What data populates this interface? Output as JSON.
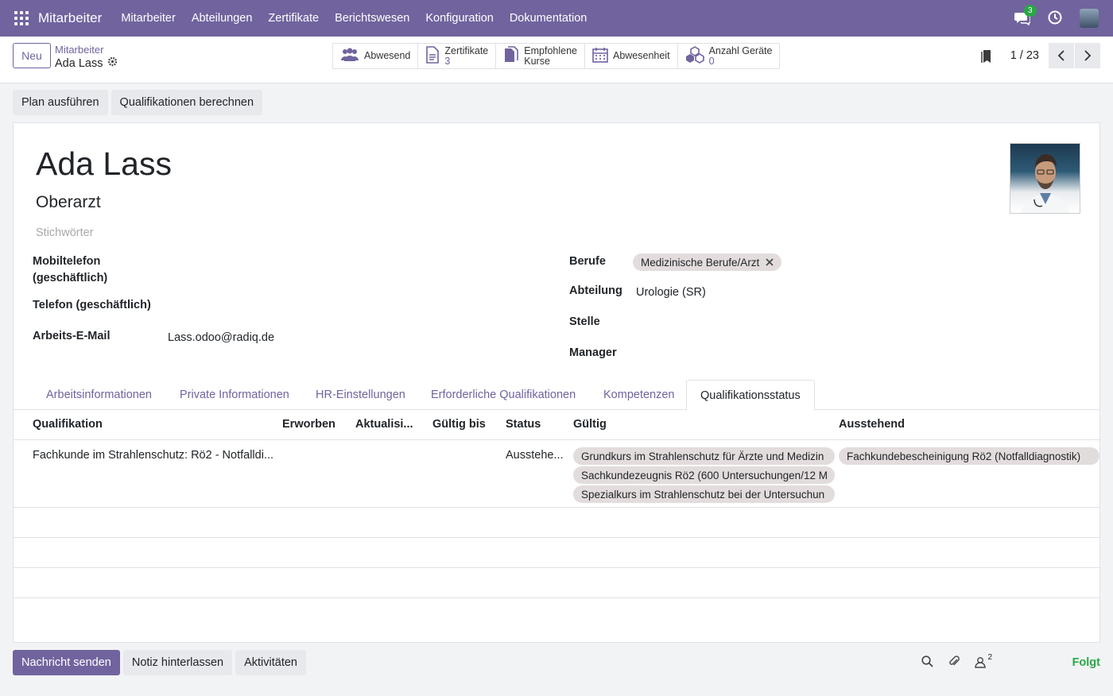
{
  "navbar": {
    "app_name": "Mitarbeiter",
    "menu": [
      "Mitarbeiter",
      "Abteilungen",
      "Zertifikate",
      "Berichtswesen",
      "Konfiguration",
      "Dokumentation"
    ],
    "chat_count": "3"
  },
  "control": {
    "new_label": "Neu",
    "breadcrumb_parent": "Mitarbeiter",
    "breadcrumb_current": "Ada Lass",
    "pager": "1 / 23"
  },
  "smart_buttons": [
    {
      "label": "Abwesend",
      "sub": ""
    },
    {
      "label": "Zertifikate",
      "sub": "3"
    },
    {
      "label": "Empfohlene",
      "sub": "Kurse"
    },
    {
      "label": "Abwesenheit",
      "sub": ""
    },
    {
      "label": "Anzahl Geräte",
      "sub": "0"
    }
  ],
  "actions": {
    "run_plan": "Plan ausführen",
    "compute_qual": "Qualifikationen berechnen"
  },
  "employee": {
    "name": "Ada Lass",
    "job_title": "Oberarzt",
    "tags_placeholder": "Stichwörter",
    "labels": {
      "mobile_1": "Mobiltelefon",
      "mobile_2": "(geschäftlich)",
      "phone": "Telefon (geschäftlich)",
      "email": "Arbeits-E-Mail",
      "professions": "Berufe",
      "department": "Abteilung",
      "job": "Stelle",
      "manager": "Manager"
    },
    "email": "Lass.odoo@radiq.de",
    "profession_tag": "Medizinische Berufe/Arzt",
    "department": "Urologie (SR)"
  },
  "tabs": [
    "Arbeitsinformationen",
    "Private Informationen",
    "HR-Einstellungen",
    "Erforderliche Qualifikationen",
    "Kompetenzen",
    "Qualifikationsstatus"
  ],
  "table": {
    "headers": [
      "Qualifikation",
      "Erworben",
      "Aktualisi...",
      "Gültig bis",
      "Status",
      "Gültig",
      "Ausstehend"
    ],
    "row": {
      "qualification": "Fachkunde im Strahlenschutz: Rö2 - Notfalldi...",
      "status": "Ausstehe...",
      "valid": [
        "Grundkurs im Strahlenschutz für Ärzte und Medizin",
        "Sachkundezeugnis Rö2 (600 Untersuchungen/12 M",
        "Spezialkurs im Strahlenschutz bei der Untersuchun"
      ],
      "pending": [
        "Fachkundebescheinigung Rö2 (Notfalldiagnostik)"
      ]
    }
  },
  "chatter": {
    "send": "Nachricht senden",
    "note": "Notiz hinterlassen",
    "activities": "Aktivitäten",
    "followers_count": "2",
    "follow": "Folgt"
  },
  "colors": {
    "brand": "#71639e",
    "follow": "#28a745"
  }
}
